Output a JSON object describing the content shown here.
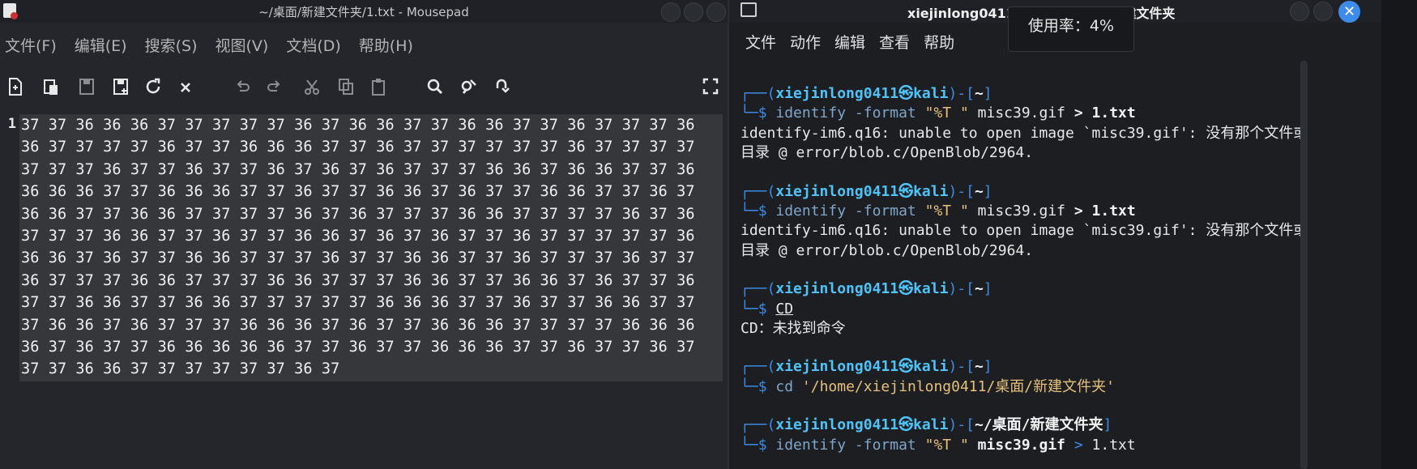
{
  "mousepad": {
    "title": "~/桌面/新建文件夹/1.txt - Mousepad",
    "menu": [
      "文件(F)",
      "编辑(E)",
      "搜索(S)",
      "视图(V)",
      "文档(D)",
      "帮助(H)"
    ],
    "line_number": "1",
    "text_lines": [
      "37 37 36 36 36 37 37 37 37 37 36 37 36 36 37 37 36 36 37 37 36 37 37 37 36",
      "36 37 37 37 37 36 37 37 36 36 36 37 37 36 37 37 37 37 37 37 36 37 37 37 37",
      "37 37 37 36 37 37 36 37 37 36 37 36 37 36 37 37 37 36 36 37 36 36 37 37 36",
      "36 36 36 37 37 36 36 36 37 37 36 37 37 36 36 37 36 37 37 36 36 37 37 36 37",
      "36 36 37 37 36 36 37 37 37 37 36 37 36 37 37 37 36 36 37 37 37 37 36 37 36",
      "37 37 37 36 36 37 37 36 37 37 36 36 37 36 37 36 37 37 36 37 37 37 37 37 36",
      "36 36 37 36 37 37 36 36 37 37 37 36 37 37 36 36 37 37 36 37 37 37 36 37 37",
      "36 37 37 37 36 36 37 37 37 36 36 37 37 37 36 36 37 37 36 36 37 36 37 37 36",
      "37 37 36 36 37 37 36 36 37 37 37 37 37 36 36 36 37 37 36 37 37 36 36 37 37",
      "37 36 36 37 36 37 37 37 36 36 36 37 36 37 37 36 36 36 37 37 37 37 36 36 36",
      "36 37 36 37 37 36 36 36 36 36 37 37 36 37 37 36 36 36 37 37 36 37 37 36 37",
      "37 37 36 36 37 37 37 37 37 37 36 37"
    ]
  },
  "terminal": {
    "title": "xiejinlong0411@kali: ~/桌面/新建文件夹",
    "menu": [
      "文件",
      "动作",
      "编辑",
      "查看",
      "帮助"
    ],
    "cpu_tooltip": "使用率：4%",
    "close_glyph": "✕",
    "prompt": {
      "open": "┌──(",
      "user": "xiejinlong0411",
      "at": "㉿",
      "host": "kali",
      "mid": ")-[",
      "close": "]",
      "corner": "└─",
      "dollar": "$"
    },
    "blocks": [
      {
        "dir": "~",
        "cmd": "identify",
        "args_pre": " -format ",
        "str": "\"%T \"",
        "file": " misc39.gif ",
        "redir": ">",
        "out": " 1.txt",
        "output": [
          "identify-im6.q16: unable to open image `misc39.gif': 没有那个文件或",
          "目录 @ error/blob.c/OpenBlob/2964."
        ]
      },
      {
        "dir": "~",
        "cmd": "identify",
        "args_pre": " -format ",
        "str": "\"%T \"",
        "file": " misc39.gif ",
        "redir": ">",
        "out": " 1.txt",
        "output": [
          "identify-im6.q16: unable to open image `misc39.gif': 没有那个文件或",
          "目录 @ error/blob.c/OpenBlob/2964."
        ]
      },
      {
        "dir": "~",
        "cmd": "CD",
        "output": [
          "CD：未找到命令"
        ]
      },
      {
        "dir": "~",
        "cmd": "cd",
        "str": " '/home/xiejinlong0411/桌面/新建文件夹'"
      },
      {
        "dir": "~/桌面/新建文件夹",
        "cmd": "identify",
        "args_pre": " -format ",
        "str": "\"%T \"",
        "file": " misc39.gif ",
        "redir": ">",
        "out": " 1.txt"
      }
    ]
  },
  "colors": {
    "prompt_frame": "#3d8be5",
    "prompt_user": "#4fc3f7",
    "accent_close": "#3d8bea"
  }
}
